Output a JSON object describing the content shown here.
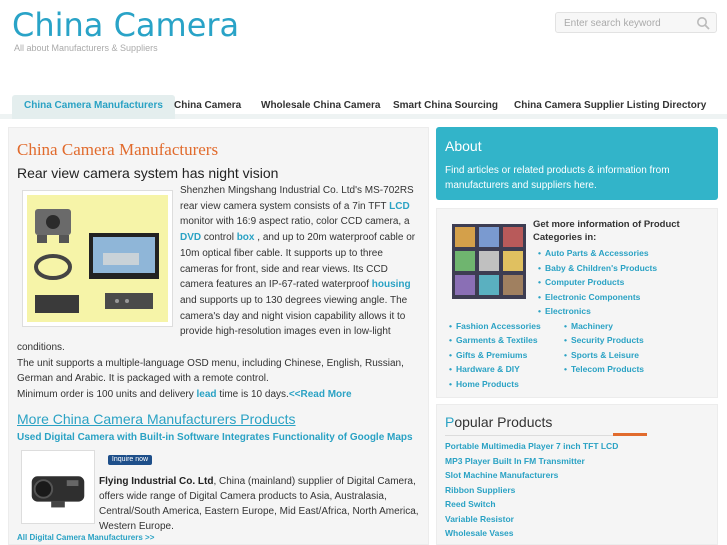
{
  "header": {
    "title": "China Camera",
    "subtitle": "All about Manufacturers & Suppliers",
    "search_placeholder": "Enter search keyword"
  },
  "nav": {
    "items": [
      {
        "label": "China Camera Manufacturers"
      },
      {
        "label": "China Camera"
      },
      {
        "label": "Wholesale China Camera"
      },
      {
        "label": "Smart China Sourcing"
      },
      {
        "label": "China Camera Supplier Listing Directory"
      }
    ],
    "active_index": 0
  },
  "main": {
    "title": "China Camera Manufacturers",
    "article": {
      "title": "Rear view camera system has night vision",
      "p1_a": "Shenzhen Mingshang Industrial Co. Ltd's MS-702RS rear view camera system consists of a 7in TFT ",
      "kw_lcd": "LCD",
      "p1_b": " monitor with 16:9 aspect ratio, color CCD camera, a ",
      "kw_dvd": "DVD",
      "p1_c": " control ",
      "kw_box": "box",
      "p1_d": " , and up to 20m waterproof cable or 10m optical fiber cable. It supports up to three cameras for front, side and rear views. Its CCD camera features an IP-67-rated waterproof ",
      "kw_housing": "housing",
      "p1_e": " and supports up to 130 degrees viewing angle. The camera's day and night vision capability allows it to provide high-resolution images even in low-light conditions.",
      "p2": "The unit supports a multiple-language OSD menu, including Chinese, English, Russian, German and Arabic. It is packaged with a remote control.",
      "p3_a": "Minimum order is 100 units and delivery ",
      "kw_lead": "lead",
      "p3_b": " time is 10 days.",
      "read_more": "<<Read More"
    },
    "more": {
      "title": "More China Camera Manufacturers Products",
      "product_title": "Used Digital Camera with Built-in Software Integrates Functionality of Google Maps",
      "inquire": "Inquire now",
      "supplier_name": "Flying Industrial Co. Ltd",
      "supplier_desc": ", China (mainland) supplier of Digital Camera, offers wide range of Digital Camera products to Asia, Australasia, Central/South America, Eastern Europe, Mid East/Africa, North America, Western Europe.",
      "all_link": "All Digital Camera Manufacturers >>"
    }
  },
  "about": {
    "title": "About",
    "text": "Find articles or related products & information from manufacturers and suppliers here."
  },
  "categories": {
    "heading": "Get more information of Product Categories in:",
    "right_items": [
      "Auto Parts & Accessories",
      "Baby & Children's Products",
      "Computer Products",
      "Electronic Components",
      "Electronics"
    ],
    "col1": [
      "Fashion Accessories",
      "Garments & Textiles",
      "Gifts & Premiums",
      "Hardware & DIY",
      "Home Products"
    ],
    "col2": [
      "Machinery",
      "Security Products",
      "Sports & Leisure",
      "Telecom Products"
    ]
  },
  "popular": {
    "title_first": "P",
    "title_rest": "opular Products",
    "items": [
      "Portable Multimedia Player 7 inch TFT LCD",
      "MP3 Player Built In FM Transmitter",
      "Slot Machine Manufacturers",
      "Ribbon Suppliers",
      "Reed Switch",
      "Variable Resistor",
      "Wholesale Vases"
    ]
  },
  "colors": {
    "accent": "#2aa2c4",
    "orange": "#e16b2d",
    "about_bg": "#32b4c9"
  }
}
